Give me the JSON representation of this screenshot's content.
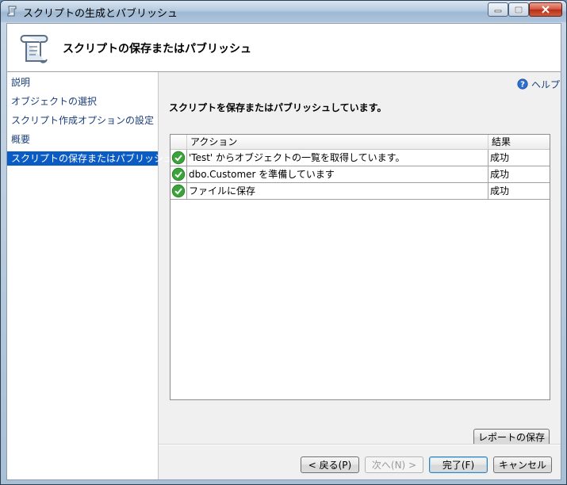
{
  "window": {
    "title": "スクリプトの生成とパブリッシュ"
  },
  "header": {
    "title": "スクリプトの保存またはパブリッシュ",
    "icon": "script-scroll-icon"
  },
  "sidebar": {
    "items": [
      {
        "label": "説明"
      },
      {
        "label": "オブジェクトの選択"
      },
      {
        "label": "スクリプト作成オプションの設定"
      },
      {
        "label": "概要"
      },
      {
        "label": "スクリプトの保存またはパブリッシュ",
        "selected": true
      }
    ]
  },
  "main": {
    "help_label": "ヘルプ",
    "status_text": "スクリプトを保存またはパブリッシュしています。",
    "grid": {
      "columns": {
        "action": "アクション",
        "result": "結果"
      },
      "rows": [
        {
          "action": "'Test' からオブジェクトの一覧を取得しています。",
          "result": "成功"
        },
        {
          "action": "dbo.Customer を準備しています",
          "result": "成功"
        },
        {
          "action": "ファイルに保存",
          "result": "成功"
        }
      ]
    },
    "save_report_label": "レポートの保存"
  },
  "footer": {
    "back_label": "< 戻る(P)",
    "next_label": "次へ(N) >",
    "finish_label": "完了(F)",
    "cancel_label": "キャンセル"
  },
  "colors": {
    "selected_nav": "#0a5bc4",
    "link_text": "#1a3e7a",
    "success_green": "#3aa33a"
  }
}
